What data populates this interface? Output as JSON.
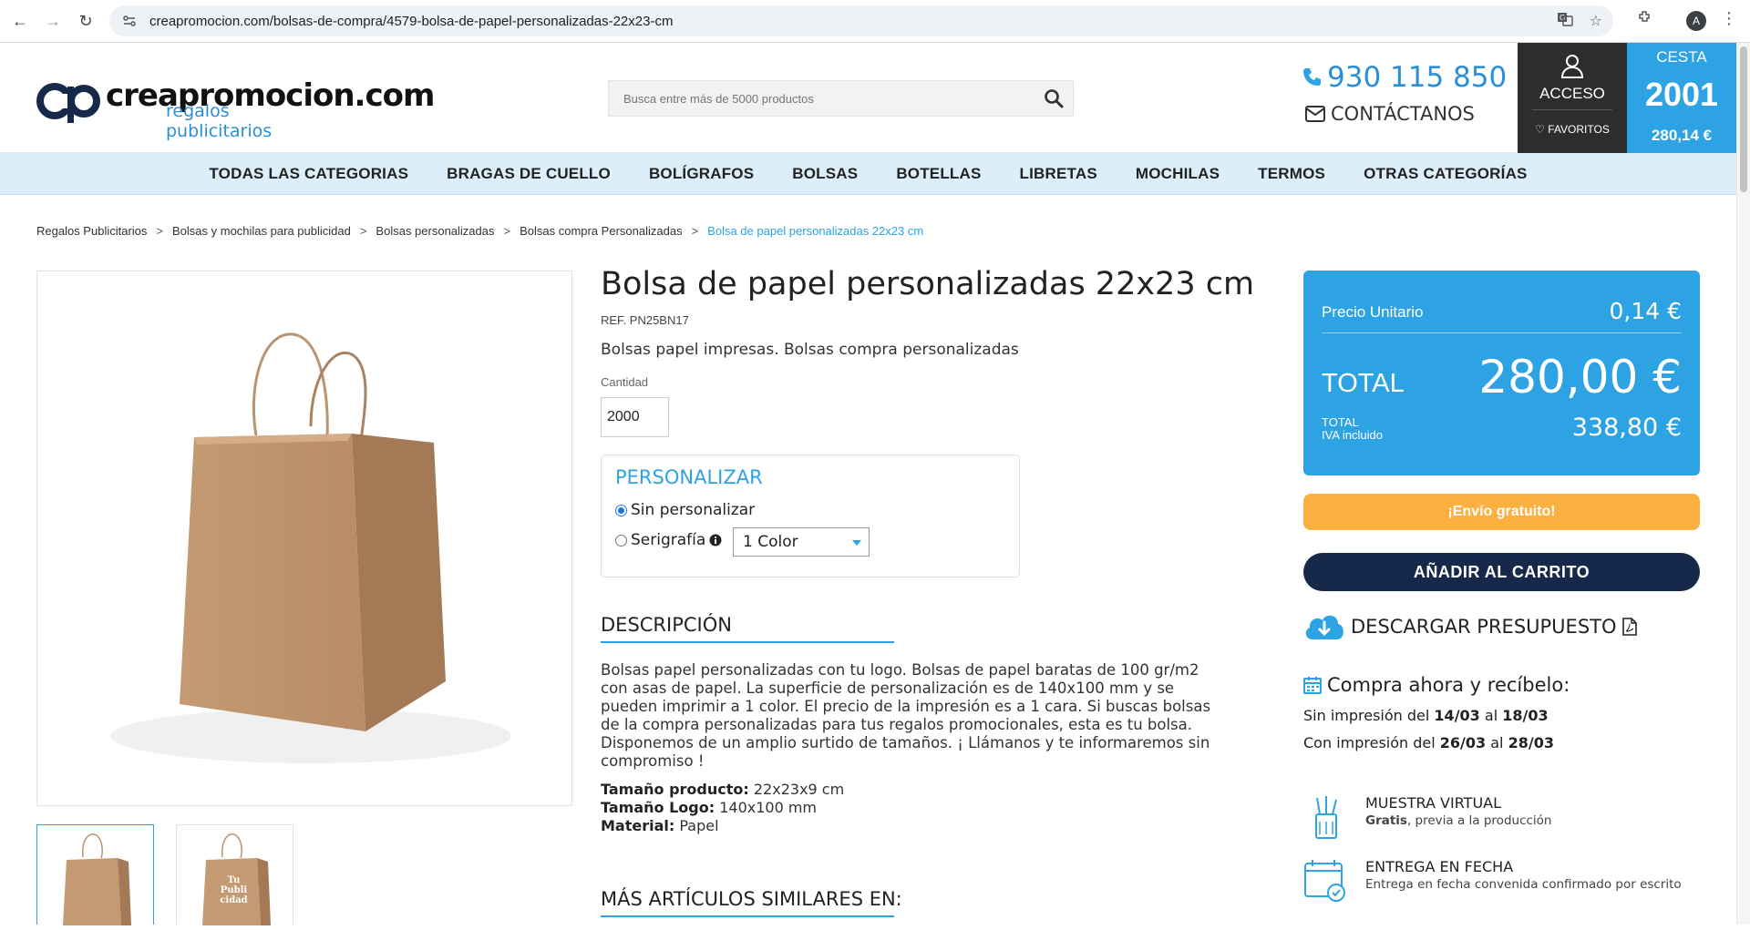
{
  "browser": {
    "url": "creapromocion.com/bolsas-de-compra/4579-bolsa-de-papel-personalizadas-22x23-cm",
    "avatar_letter": "A"
  },
  "header": {
    "logo_text": "creapromocion.com",
    "logo_sub": "regalos publicitarios",
    "search_placeholder": "Busca entre más de 5000 productos",
    "phone": "930 115 850",
    "contact": "CONTÁCTANOS",
    "account_label": "ACCESO",
    "favorites_label": "FAVORITOS",
    "cart_label": "CESTA",
    "cart_count": "2001",
    "cart_amount": "280,14 €"
  },
  "menu": [
    "TODAS LAS CATEGORIAS",
    "BRAGAS DE CUELLO",
    "BOLÍGRAFOS",
    "BOLSAS",
    "BOTELLAS",
    "LIBRETAS",
    "MOCHILAS",
    "TERMOS",
    "OTRAS CATEGORÍAS"
  ],
  "breadcrumb": [
    "Regalos Publicitarios",
    "Bolsas y mochilas para publicidad",
    "Bolsas personalizadas",
    "Bolsas compra Personalizadas",
    "Bolsa de papel personalizadas 22x23 cm"
  ],
  "product": {
    "title": "Bolsa de papel personalizadas 22x23 cm",
    "ref": "REF. PN25BN17",
    "subtitle": "Bolsas papel impresas. Bolsas compra personalizadas",
    "qty_label": "Cantidad",
    "qty_value": "2000",
    "thumb2_text": "Tu Publi cidad"
  },
  "customize": {
    "title": "PERSONALIZAR",
    "option1": "Sin personalizar",
    "option2": "Serigrafía",
    "select_value": "1 Color"
  },
  "description": {
    "title": "DESCRIPCIÓN",
    "text": "Bolsas papel personalizadas con tu logo. Bolsas de papel baratas de 100 gr/m2 con asas de papel. La superficie de personalización es de 140x100 mm y se pueden imprimir a 1 color. El precio de la impresión es a 1 cara. Si buscas bolsas de la compra personalizadas para tus regalos promocionales, esta es tu bolsa. Disponemos de un amplio surtido de tamaños. ¡ Llámanos y te informaremos sin compromiso !",
    "spec1_label": "Tamaño producto:",
    "spec1_value": "22x23x9 cm",
    "spec2_label": "Tamaño Logo:",
    "spec2_value": "140x100 mm",
    "spec3_label": "Material:",
    "spec3_value": "Papel",
    "similar_title": "MÁS ARTÍCULOS SIMILARES EN:"
  },
  "price": {
    "unit_label": "Precio Unitario",
    "unit_value": "0,14 €",
    "total_label": "TOTAL",
    "total_value": "280,00 €",
    "iva_label1": "TOTAL",
    "iva_label2": "IVA incluido",
    "iva_value": "338,80 €",
    "shipping": "¡Envío gratuito!",
    "add_cart": "AÑADIR AL CARRITO",
    "download": "DESCARGAR PRESUPUESTO"
  },
  "delivery": {
    "title": "Compra ahora y recíbelo:",
    "line1_prefix": "Sin impresión del",
    "line1_from": "14/03",
    "line1_mid": "al",
    "line1_to": "18/03",
    "line2_prefix": "Con impresión del",
    "line2_from": "26/03",
    "line2_mid": "al",
    "line2_to": "28/03"
  },
  "features": [
    {
      "title": "MUESTRA VIRTUAL",
      "sub_bold": "Gratis",
      "sub": ", previa a la producción"
    },
    {
      "title": "ENTREGA EN FECHA",
      "sub_bold": "",
      "sub": "Entrega en fecha convenida confirmado por escrito"
    }
  ],
  "colors": {
    "accent": "#2ea3e3",
    "dark": "#16294a",
    "orange": "#fbb040",
    "menu_bg": "#dbeef9"
  }
}
